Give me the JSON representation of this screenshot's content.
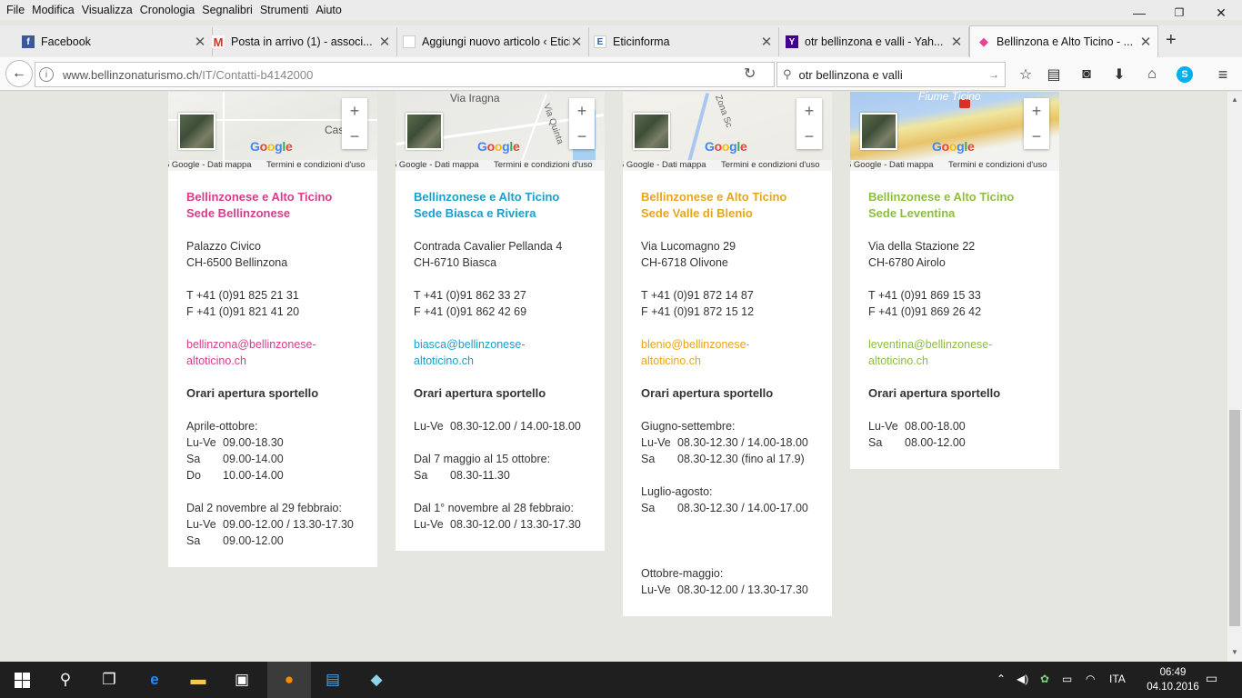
{
  "menu": [
    "File",
    "Modifica",
    "Visualizza",
    "Cronologia",
    "Segnalibri",
    "Strumenti",
    "Aiuto"
  ],
  "window_controls": {
    "minimize": "—",
    "restore": "❐",
    "close": "✕"
  },
  "tabs": [
    {
      "title": "Facebook",
      "icon": "facebook-icon",
      "color": "#3b5998",
      "glyph": "f"
    },
    {
      "title": "Posta in arrivo (1) - associ...",
      "icon": "gmail-icon",
      "color": "#d93025",
      "glyph": "M"
    },
    {
      "title": "Aggiungi nuovo articolo ‹ Etici...",
      "icon": "wordpress-icon",
      "color": "#ffffff",
      "glyph": ""
    },
    {
      "title": "Eticinforma",
      "icon": "eticinforma-icon",
      "color": "#2a5ea8",
      "glyph": "E"
    },
    {
      "title": "otr bellinzona e valli - Yah...",
      "icon": "yahoo-icon",
      "color": "#400090",
      "glyph": "Y"
    },
    {
      "title": "Bellinzona e Alto Ticino - ...",
      "icon": "bellinzona-icon",
      "color": "#e84393",
      "glyph": "◆",
      "active": true
    }
  ],
  "newtab": "+",
  "nav": {
    "url_domain": "www.bellinzonaturismo.ch",
    "url_path": "/IT/Contatti-b4142000",
    "search_value": "otr bellinzona e valli"
  },
  "cards": [
    {
      "accent": "#d63c8e",
      "map_label": "Castello",
      "map_text": "",
      "region": "Bellinzonese e Alto Ticino",
      "office": "Sede Bellinzonese",
      "addr1": "Palazzo Civico",
      "addr2": "CH-6500 Bellinzona",
      "tel": "T +41 (0)91 825 21 31",
      "fax": "F +41 (0)91 821 41 20",
      "email1": "bellinzona@bellinzonese-",
      "email2": "altoticino.ch",
      "hours_title": "Orari apertura sportello",
      "hours": [
        [
          {
            "d": "",
            "t": "Aprile-ottobre:"
          },
          {
            "d": "Lu-Ve",
            "t": "09.00-18.30"
          },
          {
            "d": "Sa",
            "t": "09.00-14.00"
          },
          {
            "d": "Do",
            "t": "10.00-14.00"
          }
        ],
        [
          {
            "d": "",
            "t": "Dal 2 novembre al 29 febbraio:"
          },
          {
            "d": "Lu-Ve",
            "t": "09.00-12.00 / 13.30-17.30"
          },
          {
            "d": "Sa",
            "t": "09.00-12.00"
          }
        ]
      ]
    },
    {
      "accent": "#1aa0c9",
      "map_label": "Via Iragna",
      "map_text": "Via Quinta",
      "region": "Bellinzonese e Alto Ticino",
      "office": "Sede Biasca e Riviera",
      "addr1": "Contrada Cavalier Pellanda 4",
      "addr2": "CH-6710 Biasca",
      "tel": "T +41 (0)91 862 33 27",
      "fax": "F +41 (0)91 862 42 69",
      "email1": "biasca@bellinzonese-",
      "email2": "altoticino.ch",
      "hours_title": "Orari apertura sportello",
      "hours": [
        [
          {
            "d": "Lu-Ve",
            "t": "08.30-12.00 / 14.00-18.00"
          }
        ],
        [
          {
            "d": "",
            "t": "Dal 7 maggio al 15 ottobre:"
          },
          {
            "d": "Sa",
            "t": "08.30-11.30"
          }
        ],
        [
          {
            "d": "",
            "t": "Dal 1° novembre al 28 febbraio:"
          },
          {
            "d": "Lu-Ve",
            "t": "08.30-12.00 / 13.30-17.30"
          }
        ]
      ]
    },
    {
      "accent": "#e8a51c",
      "map_label": "",
      "map_text": "Zona Sc",
      "region": "Bellinzonese e Alto Ticino",
      "office": "Sede Valle di Blenio",
      "addr1": "Via Lucomagno 29",
      "addr2": "CH-6718 Olivone",
      "tel": "T +41 (0)91 872 14 87",
      "fax": "F +41 (0)91 872 15 12",
      "email1": "blenio@bellinzonese-",
      "email2": "altoticino.ch",
      "hours_title": "Orari apertura sportello",
      "hours": [
        [
          {
            "d": "",
            "t": "Giugno-settembre:"
          },
          {
            "d": "Lu-Ve",
            "t": "08.30-12.30 / 14.00-18.00"
          },
          {
            "d": "Sa",
            "t": "08.30-12.30 (fino al 17.9)"
          }
        ],
        [
          {
            "d": "",
            "t": "Luglio-agosto:"
          },
          {
            "d": "Sa",
            "t": "08.30-12.30 / 14.00-17.00"
          }
        ],
        [
          {
            "d": "",
            "t": ""
          }
        ],
        [
          {
            "d": "",
            "t": "Ottobre-maggio:"
          },
          {
            "d": "Lu-Ve",
            "t": "08.30-12.00 / 13.30-17.30"
          }
        ]
      ]
    },
    {
      "accent": "#8cbf3f",
      "map_label": "Fiume Ticino",
      "map_text": "",
      "region": "Bellinzonese e Alto Ticino",
      "office": "Sede Leventina",
      "addr1": "Via della Stazione 22",
      "addr2": "CH-6780 Airolo",
      "tel": "T +41 (0)91 869 15 33",
      "fax": "F +41 (0)91 869 26 42",
      "email1": "leventina@bellinzonese-",
      "email2": "altoticino.ch",
      "hours_title": "Orari apertura sportello",
      "hours": [
        [
          {
            "d": "Lu-Ve",
            "t": "08.00-18.00"
          },
          {
            "d": "Sa",
            "t": "08.00-12.00"
          }
        ]
      ]
    }
  ],
  "map": {
    "attr1": "5 Google - Dati mappa",
    "attr2": "Termini e condizioni d'uso",
    "logo": "Google",
    "zoom_in": "+",
    "zoom_out": "−"
  },
  "taskbar": {
    "lang": "ITA",
    "time": "06:49",
    "date": "04.10.2016"
  }
}
